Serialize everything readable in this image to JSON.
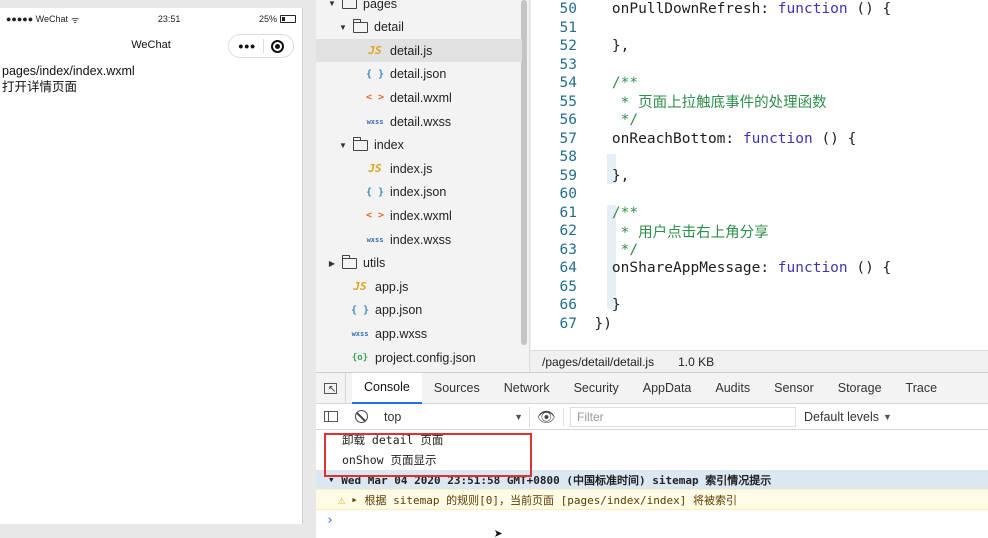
{
  "simulator": {
    "status": {
      "carrier": "●●●●● WeChat",
      "wifi": "ᯤ",
      "time": "23:51",
      "battery": "25%"
    },
    "nav_title": "WeChat",
    "capsule_more": "•••",
    "content": [
      "pages/index/index.wxml",
      "打开详情页面"
    ]
  },
  "explorer": {
    "items": [
      {
        "label": "pages",
        "type": "folder",
        "expanded": true,
        "depth": 0
      },
      {
        "label": "detail",
        "type": "folder",
        "expanded": true,
        "depth": 1
      },
      {
        "label": "detail.js",
        "type": "js",
        "icon": "JS",
        "depth": 2,
        "selected": true
      },
      {
        "label": "detail.json",
        "type": "json",
        "icon": "{ }",
        "depth": 2
      },
      {
        "label": "detail.wxml",
        "type": "wxml",
        "icon": "< >",
        "depth": 2
      },
      {
        "label": "detail.wxss",
        "type": "wxss",
        "icon": "wxss",
        "depth": 2
      },
      {
        "label": "index",
        "type": "folder",
        "expanded": true,
        "depth": 1
      },
      {
        "label": "index.js",
        "type": "js",
        "icon": "JS",
        "depth": 2
      },
      {
        "label": "index.json",
        "type": "json",
        "icon": "{ }",
        "depth": 2
      },
      {
        "label": "index.wxml",
        "type": "wxml",
        "icon": "< >",
        "depth": 2
      },
      {
        "label": "index.wxss",
        "type": "wxss",
        "icon": "wxss",
        "depth": 2
      },
      {
        "label": "utils",
        "type": "folder",
        "expanded": false,
        "depth": 0
      },
      {
        "label": "app.js",
        "type": "js",
        "icon": "JS",
        "depth": 1
      },
      {
        "label": "app.json",
        "type": "json",
        "icon": "{ }",
        "depth": 1
      },
      {
        "label": "app.wxss",
        "type": "wxss",
        "icon": "wxss",
        "depth": 1
      },
      {
        "label": "project.config.json",
        "type": "config",
        "icon": "{o}",
        "depth": 1
      }
    ]
  },
  "editor": {
    "lines": [
      {
        "n": "50",
        "parts": [
          [
            "",
            "    onPullDownRefresh: "
          ],
          [
            "kw",
            "function"
          ],
          [
            "",
            " () {"
          ]
        ]
      },
      {
        "n": "51",
        "parts": []
      },
      {
        "n": "52",
        "parts": [
          [
            "",
            "    },"
          ]
        ]
      },
      {
        "n": "53",
        "parts": []
      },
      {
        "n": "54",
        "parts": [
          [
            "cm",
            "    /**"
          ]
        ]
      },
      {
        "n": "55",
        "parts": [
          [
            "cm",
            "     * 页面上拉触底事件的处理函数"
          ]
        ]
      },
      {
        "n": "56",
        "parts": [
          [
            "cm",
            "     */"
          ]
        ]
      },
      {
        "n": "57",
        "parts": [
          [
            "",
            "    onReachBottom: "
          ],
          [
            "kw",
            "function"
          ],
          [
            "",
            " () {"
          ]
        ]
      },
      {
        "n": "58",
        "parts": []
      },
      {
        "n": "59",
        "parts": [
          [
            "",
            "    },"
          ]
        ]
      },
      {
        "n": "60",
        "parts": []
      },
      {
        "n": "61",
        "parts": [
          [
            "cm",
            "    /**"
          ]
        ]
      },
      {
        "n": "62",
        "parts": [
          [
            "cm",
            "     * 用户点击右上角分享"
          ]
        ]
      },
      {
        "n": "63",
        "parts": [
          [
            "cm",
            "     */"
          ]
        ]
      },
      {
        "n": "64",
        "parts": [
          [
            "",
            "    onShareAppMessage: "
          ],
          [
            "kw",
            "function"
          ],
          [
            "",
            " () {"
          ]
        ]
      },
      {
        "n": "65",
        "parts": []
      },
      {
        "n": "66",
        "parts": [
          [
            "",
            "    }"
          ]
        ]
      },
      {
        "n": "67",
        "parts": [
          [
            "",
            "  })"
          ]
        ]
      }
    ]
  },
  "statusline": {
    "path": "/pages/detail/detail.js",
    "size": "1.0 KB"
  },
  "devtools": {
    "tabs": [
      "Console",
      "Sources",
      "Network",
      "Security",
      "AppData",
      "Audits",
      "Sensor",
      "Storage",
      "Trace"
    ],
    "active_tab": "Console",
    "context": "top",
    "filter_placeholder": "Filter",
    "levels": "Default levels",
    "logs": [
      "卸载 detail 页面",
      "onShow 页面显示"
    ],
    "group_line": "Wed Mar 04 2020 23:51:58 GMT+0800 (中国标准时间) sitemap 索引情况提示",
    "warning": "根据 sitemap 的规则[0]，当前页面 [pages/index/index] 将被索引",
    "prompt": "›"
  }
}
